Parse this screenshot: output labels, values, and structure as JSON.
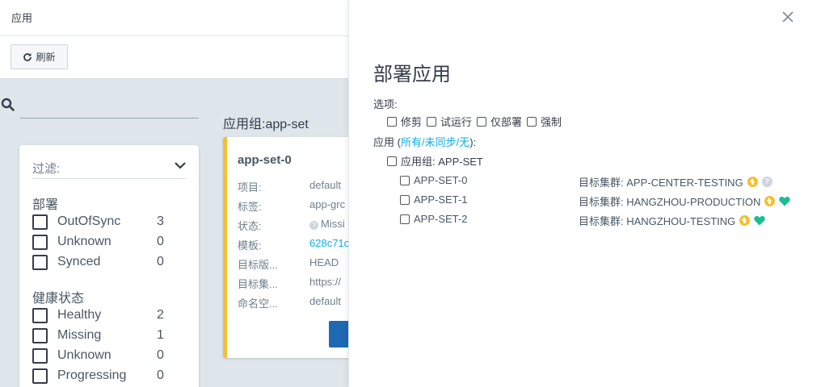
{
  "topbar": {
    "title": "应用"
  },
  "toolbar": {
    "refresh_label": "刷新"
  },
  "filters": {
    "header": "过滤:",
    "sync": {
      "title": "部署",
      "items": [
        {
          "label": "OutOfSync",
          "count": "3"
        },
        {
          "label": "Unknown",
          "count": "0"
        },
        {
          "label": "Synced",
          "count": "0"
        }
      ]
    },
    "health": {
      "title": "健康状态",
      "items": [
        {
          "label": "Healthy",
          "count": "2"
        },
        {
          "label": "Missing",
          "count": "1"
        },
        {
          "label": "Unknown",
          "count": "0"
        },
        {
          "label": "Progressing",
          "count": "0"
        }
      ]
    }
  },
  "app_group_title": "应用组:app-set",
  "card": {
    "name": "app-set-0",
    "rows": [
      {
        "k": "项目:",
        "v": "default"
      },
      {
        "k": "标签:",
        "v": "app-grc"
      },
      {
        "k": "状态:",
        "v": "Missi"
      },
      {
        "k": "模板:",
        "v": "628c71c"
      },
      {
        "k": "目标版...",
        "v": "HEAD"
      },
      {
        "k": "目标集...",
        "v": "https://"
      },
      {
        "k": "命名空...",
        "v": "default"
      }
    ]
  },
  "panel": {
    "title": "部署应用",
    "options_label": "选项:",
    "options": [
      "修剪",
      "试运行",
      "仅部署",
      "强制"
    ],
    "apps_prefix": "应用 (",
    "apps_all": "所有",
    "apps_sep1": "/",
    "apps_out_of_sync": "未同步",
    "apps_sep2": "/",
    "apps_none": "无",
    "apps_suffix": "):",
    "group_label": "应用组: APP-SET",
    "apps": [
      {
        "name": "APP-SET-0",
        "target": "目标集群: APP-CENTER-TESTING",
        "health": "unknown"
      },
      {
        "name": "APP-SET-1",
        "target": "目标集群: HANGZHOU-PRODUCTION",
        "health": "healthy"
      },
      {
        "name": "APP-SET-2",
        "target": "目标集群: HANGZHOU-TESTING",
        "health": "healthy"
      }
    ],
    "colors": {
      "out_of_sync": "#f4c030",
      "healthy": "#18be94",
      "unknown": "#ccd6dd",
      "link": "#0dadea"
    }
  }
}
